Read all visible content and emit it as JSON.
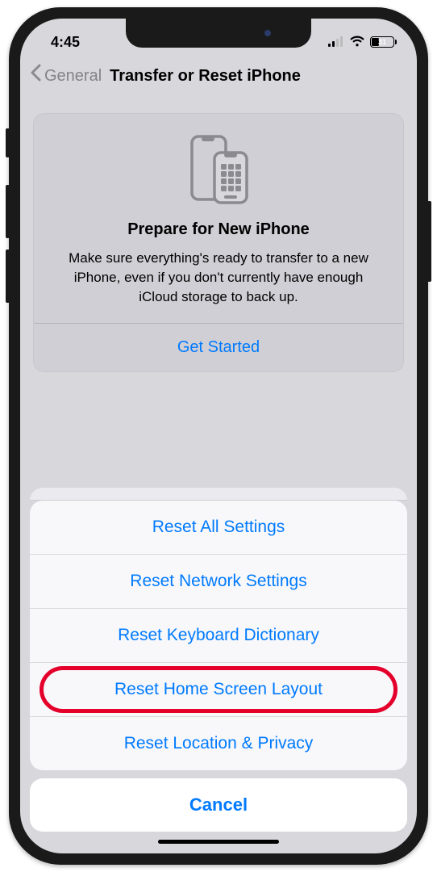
{
  "status": {
    "time": "4:45",
    "battery_percent": "31"
  },
  "nav": {
    "back_label": "General",
    "title": "Transfer or Reset iPhone"
  },
  "card": {
    "title": "Prepare for New iPhone",
    "description": "Make sure everything's ready to transfer to a new iPhone, even if you don't currently have enough iCloud storage to back up.",
    "action": "Get Started"
  },
  "sheet": {
    "items": [
      "Reset All Settings",
      "Reset Network Settings",
      "Reset Keyboard Dictionary",
      "Reset Home Screen Layout",
      "Reset Location & Privacy"
    ],
    "highlighted_index": 3,
    "cancel": "Cancel"
  }
}
